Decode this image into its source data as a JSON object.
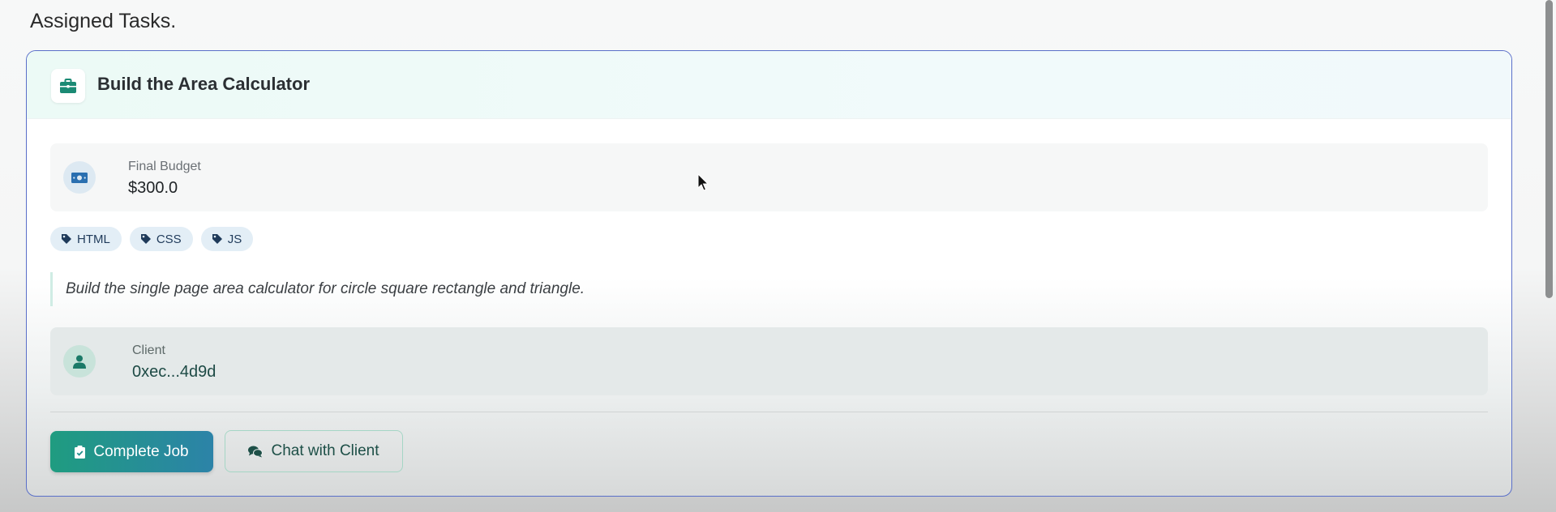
{
  "page": {
    "heading": "Assigned Tasks."
  },
  "task": {
    "title": "Build the Area Calculator",
    "header_icon": "briefcase-icon",
    "budget": {
      "label": "Final Budget",
      "value": "$300.0",
      "icon": "money-bill-icon"
    },
    "tags": [
      {
        "label": "HTML",
        "icon": "tag-icon"
      },
      {
        "label": "CSS",
        "icon": "tag-icon"
      },
      {
        "label": "JS",
        "icon": "tag-icon"
      }
    ],
    "description": "Build the single page area calculator for circle square rectangle and triangle.",
    "client": {
      "label": "Client",
      "value": "0xec...4d9d",
      "icon": "user-icon"
    },
    "actions": {
      "complete_label": "Complete Job",
      "complete_icon": "clipboard-check-icon",
      "chat_label": "Chat with Client",
      "chat_icon": "comments-icon"
    }
  },
  "colors": {
    "card_border": "#5a6fc9",
    "accent_teal": "#1f9c80",
    "accent_blue": "#2c83a8",
    "tag_bg": "#e3eef6"
  }
}
